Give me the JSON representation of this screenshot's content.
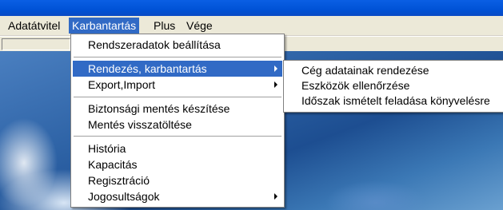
{
  "menubar": {
    "items": [
      "Adatátvitel",
      "Karbantartás",
      "Plus",
      "Vége"
    ]
  },
  "menu": {
    "items": [
      {
        "label": "Rendszeradatok beállítása"
      },
      {
        "label": "Rendezés, karbantartás",
        "submenu": true,
        "highlighted": true
      },
      {
        "label": "Export,Import",
        "submenu": true
      },
      {
        "label": "Biztonsági mentés készítése"
      },
      {
        "label": "Mentés visszatöltése"
      },
      {
        "label": "História"
      },
      {
        "label": "Kapacitás"
      },
      {
        "label": "Regisztráció"
      },
      {
        "label": "Jogosultságok",
        "submenu": true
      }
    ]
  },
  "submenu": {
    "items": [
      "Cég adatainak rendezése",
      "Eszközök ellenőrzése",
      "Időszak ismételt feladása könyvelésre"
    ]
  },
  "colors": {
    "highlight": "#316ac5",
    "menu_bg": "#ffffff",
    "menubar_bg": "#ece9d8",
    "titlebar": "#0052d6"
  }
}
